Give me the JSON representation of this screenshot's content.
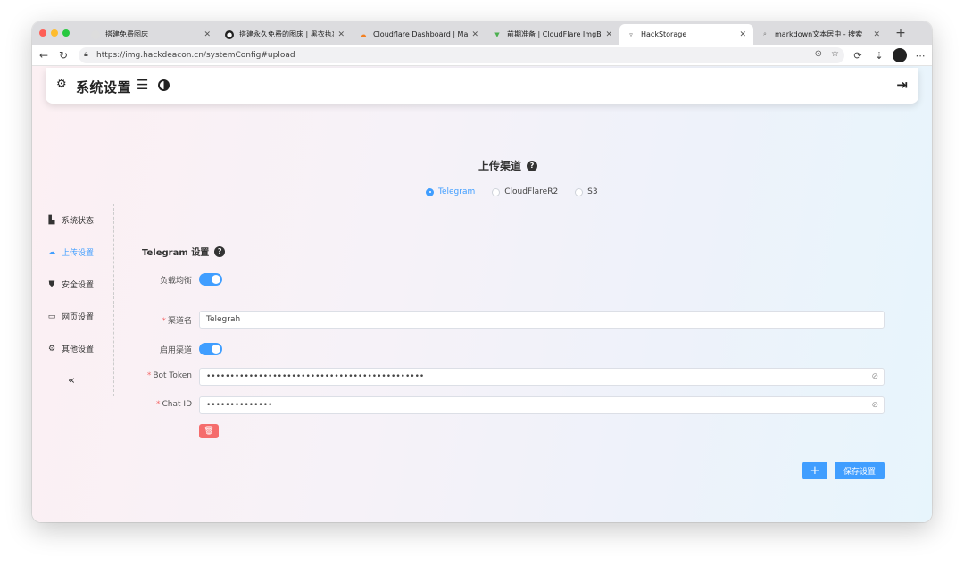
{
  "browser": {
    "tabs": [
      {
        "title": "搭建免费图床"
      },
      {
        "title": "搭建永久免费的图床 | 黑衣执事"
      },
      {
        "title": "Cloudflare Dashboard | Manag"
      },
      {
        "title": "前期准备 | CloudFlare ImgBed"
      },
      {
        "title": "HackStorage"
      },
      {
        "title": "markdown文本居中 - 搜索"
      }
    ],
    "active_tab": 4,
    "url": "https://img.hackdeacon.cn/systemConfig#upload"
  },
  "header": {
    "title": "系统设置"
  },
  "upload": {
    "section_title": "上传渠道",
    "channels": [
      "Telegram",
      "CloudFlareR2",
      "S3"
    ],
    "selected_channel": "Telegram",
    "form_title": "Telegram 设置",
    "load_balance_label": "负载均衡",
    "load_balance_on": true,
    "fields": {
      "channel_name_label": "渠道名",
      "channel_name_value": "Telegrah",
      "enable_label": "启用渠道",
      "enable_on": true,
      "bot_token_label": "Bot Token",
      "bot_token_value": "••••••••••••••••••••••••••••••••••••••••••••••",
      "chat_id_label": "Chat ID",
      "chat_id_value": "••••••••••••••"
    },
    "add_label": "+",
    "save_label": "保存设置"
  },
  "sidebar": {
    "items": [
      {
        "label": "系统状态",
        "icon": "chart-icon"
      },
      {
        "label": "上传设置",
        "icon": "cloud-upload-icon"
      },
      {
        "label": "安全设置",
        "icon": "shield-icon"
      },
      {
        "label": "网页设置",
        "icon": "monitor-icon"
      },
      {
        "label": "其他设置",
        "icon": "gear-icon"
      }
    ],
    "active_index": 1,
    "collapse_label": "«"
  },
  "colors": {
    "accent": "#409eff",
    "danger": "#f56c6c"
  }
}
